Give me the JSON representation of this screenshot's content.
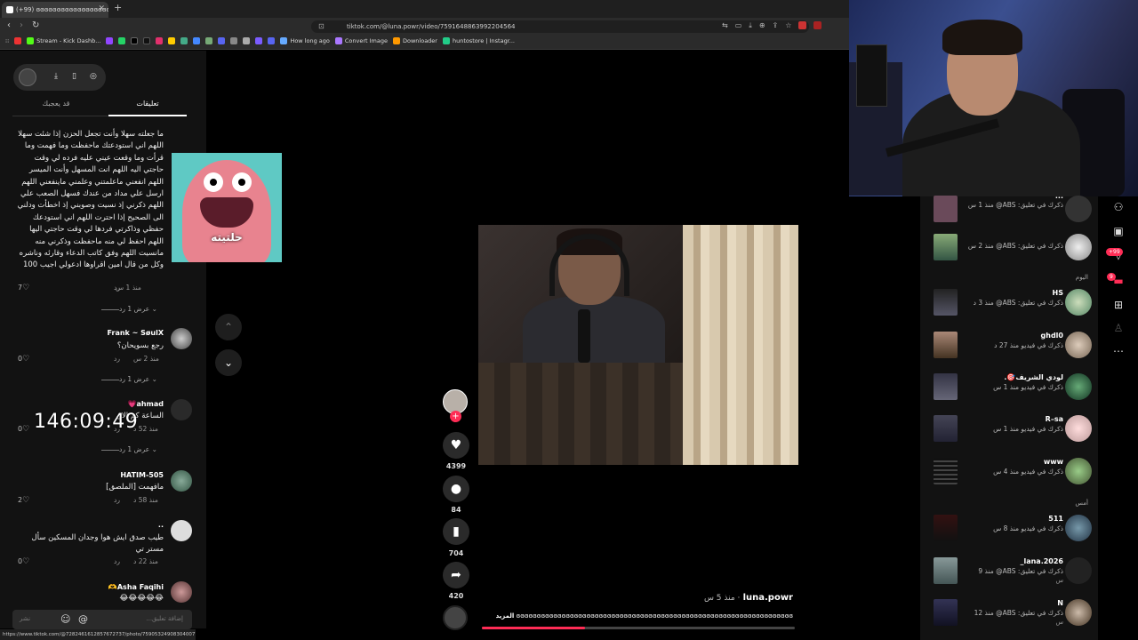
{
  "browser": {
    "tab_title": "(+99) ɞɞɞɞɞɞɞɞɞɞɞɞɞɞɞɞɞɞ",
    "url": "tiktok.com/@luna.powr/video/7591648863992204564",
    "bookmarks": [
      "Stream - Kick Dashb...",
      "How long ago",
      "Convert Image",
      "Downloader",
      "huntostore | Instagr..."
    ],
    "status_url": "https://www.tiktok.com/@7282461612857672737/photo/7590532490830400771"
  },
  "comments_panel": {
    "tabs": [
      "تعليقات",
      "قد يعجبك"
    ],
    "top_comment": {
      "text": "ما جعلته سهلا وأنت تجعل الحزن إذا شئت سهلا اللهم اني استودعتك ماحفظت وما فهمت وما قرأت وما وقعت عيني عليه فرده لي وقت حاجتي اليه اللهم انت المسهل وأنت الميسر اللهم انفعني ماعلمتني وعلمني ماينفعني اللهم ارسل علي مداد من عندك فسهل الصعب علي اللهم ذكرني إذ نسيت وصوبني إذ اخطأت ودلني الى الصحيح إذا احترت اللهم اني استودعك حفظي وذاكرتي فردها لي وقت حاجتي اليها اللهم احفظ لي منه ماحفظت وذكرني منه مانسيت اللهم وفق كاتب الدعاء وقارئه وناشره وكل من قال امين اقراوها ادعولي اجيب 100",
      "time": "منذ 1 س",
      "reply_label": "رد",
      "likes": "7",
      "view_replies": "عرض 1 رد"
    },
    "comments": [
      {
        "name": "Frank ~ SøulX",
        "text": "رجع بسويحان؟",
        "time": "منذ 2 س",
        "reply_label": "رد",
        "likes": "0",
        "view_replies": "عرض 1 رد"
      },
      {
        "name": "ahmad💗",
        "text": "الساعة كم الان",
        "time": "منذ 52 د",
        "reply_label": "رد",
        "likes": "0",
        "view_replies": "عرض 1 رد"
      },
      {
        "name": "HATIM-505",
        "text": "مافهمت [الملصق]",
        "time": "منذ 58 د",
        "reply_label": "رد",
        "likes": "2"
      },
      {
        "name": "..",
        "text": "طيب صدق ايش هوا وجدان المسكين سأل مستر تي",
        "time": "منذ 22 د",
        "reply_label": "رد",
        "likes": "0"
      },
      {
        "name": "Asha Faqihi🫶",
        "text": "😂😂😂😂😂"
      }
    ],
    "input_placeholder": "إضافة تعليق...",
    "post_label": "نشر"
  },
  "overlay": {
    "timer": "146:09:49"
  },
  "video": {
    "caption_text": "حلتيته",
    "author": "luna.powr",
    "posted": "منذ 5 س",
    "description": "ɞɞɞɞɞɞɞɞɞɞɞɞɞɞɞɞɞɞɞɞɞɞɞɞɞɞɞɞɞɞɞɞɞɞɞɞɞɞɞɞɞɞɞɞɞɞɞɞɞɞɞɞɞɞɞɞɞɞɞɞɞɞɞɞɞɞɞ",
    "more_label": "المزيد",
    "likes": "4399",
    "comments": "84",
    "saves": "704",
    "shares": "420",
    "progress": 0.33
  },
  "notifications": {
    "day_today": "اليوم",
    "day_yesterday": "أمس",
    "items": [
      {
        "name": "...",
        "text": "ذكرك في تعليق: ABS@ منذ 1 س"
      },
      {
        "name": "",
        "text": "ذكرك في تعليق: ABS@ منذ 2 س"
      },
      {
        "name": "HS",
        "text": "ذكرك في تعليق: ABS@ منذ 3 د"
      },
      {
        "name": "ghdl0",
        "text": "ذكرك في فيديو منذ 27 د"
      },
      {
        "name": "لودي الشريف🎯.",
        "text": "ذكرك في فيديو منذ 1 س"
      },
      {
        "name": "R–sa",
        "text": "ذكرك في فيديو منذ 1 س"
      },
      {
        "name": "www",
        "text": "ذكرك في فيديو منذ 4 س"
      },
      {
        "name": "511",
        "text": "ذكرك في فيديو منذ 8 س"
      },
      {
        "name": "lana.2026_",
        "text": "ذكرك في تعليق: ABS@ منذ 9",
        "text2": "س"
      },
      {
        "name": "N",
        "text": "ذكرك في تعليق: ABS@ منذ 12",
        "text2": "س"
      }
    ]
  },
  "right_rail": {
    "badge_inbox": "+99",
    "badge_msgs": "9"
  }
}
